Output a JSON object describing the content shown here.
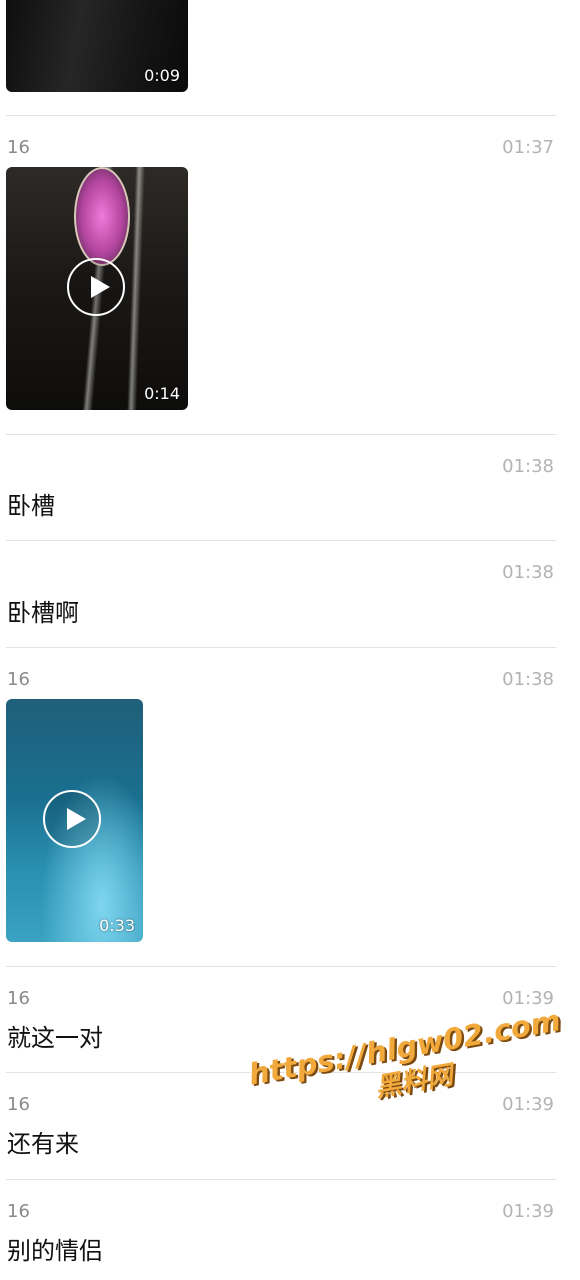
{
  "messages": [
    {
      "type": "video",
      "duration": "0:09"
    },
    {
      "type": "video",
      "sender": "16",
      "time": "01:37",
      "duration": "0:14"
    },
    {
      "type": "text",
      "time": "01:38",
      "text": "卧槽"
    },
    {
      "type": "text",
      "time": "01:38",
      "text": "卧槽啊"
    },
    {
      "type": "video",
      "sender": "16",
      "time": "01:38",
      "duration": "0:33"
    },
    {
      "type": "text",
      "sender": "16",
      "time": "01:39",
      "text": "就这一对"
    },
    {
      "type": "text",
      "sender": "16",
      "time": "01:39",
      "text": "还有来"
    },
    {
      "type": "text",
      "sender": "16",
      "time": "01:39",
      "text": "别的情侣"
    }
  ],
  "watermark": {
    "url": "https://hlgw02.com",
    "name": "黑料网"
  },
  "colors": {
    "divider": "#e2e2e2",
    "time_text": "#b3b3b3",
    "sender_text": "#8a8a8a",
    "watermark": "#f2a93b"
  }
}
